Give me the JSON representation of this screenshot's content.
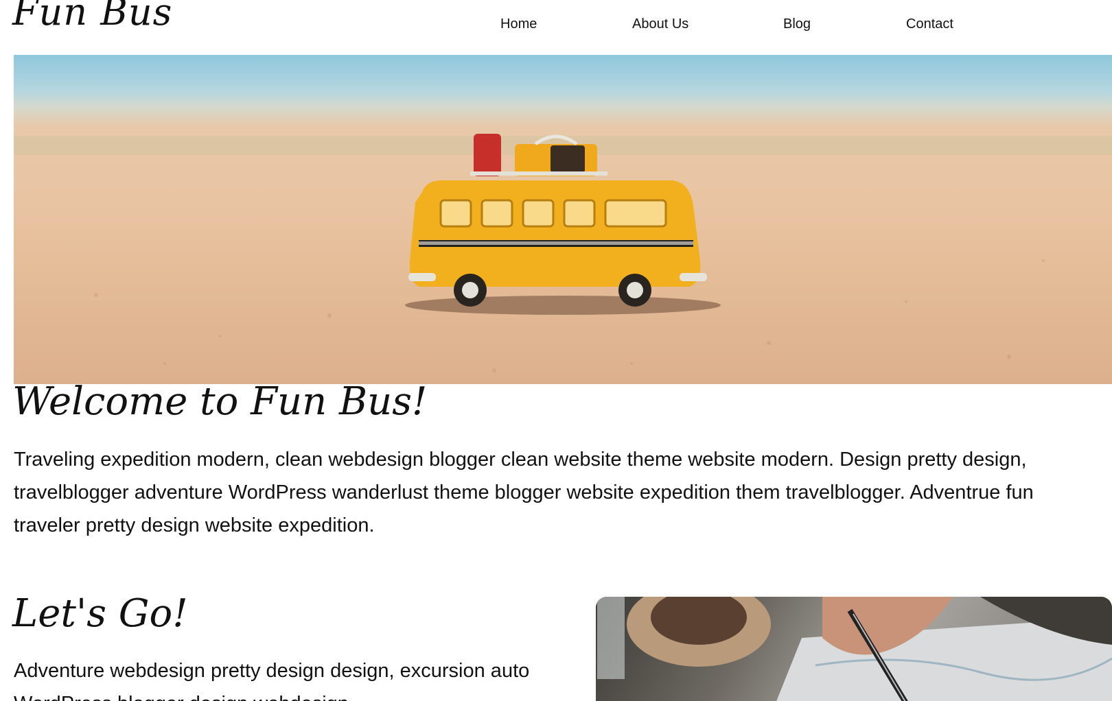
{
  "site": {
    "logo": "Fun Bus"
  },
  "nav": {
    "items": [
      {
        "label": "Home"
      },
      {
        "label": "About Us"
      },
      {
        "label": "Blog"
      },
      {
        "label": "Contact"
      }
    ]
  },
  "hero": {
    "image": "toy-bus-on-beach-photo"
  },
  "welcome": {
    "title": "Welcome to Fun Bus!",
    "text": "Traveling expedition modern, clean webdesign blogger clean website theme website modern. Design pretty design, travelblogger adventure WordPress wanderlust theme blogger website expedition them travelblogger. Adventrue fun traveler pretty design website expedition."
  },
  "lets_go": {
    "title": "Let's Go!",
    "text": "Adventure webdesign pretty design design, excursion auto WordPress blogger design webdesign",
    "image": "map-and-pen-photo"
  },
  "colors": {
    "text": "#111111",
    "background": "#ffffff",
    "bus_yellow": "#f2b01e"
  }
}
